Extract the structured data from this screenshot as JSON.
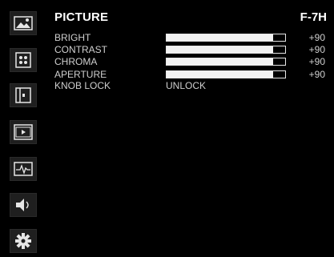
{
  "menu": {
    "title": "PICTURE",
    "model": "F-7H"
  },
  "sidebar": {
    "items": [
      {
        "icon": "picture-icon",
        "active": true
      },
      {
        "icon": "color-dots-icon"
      },
      {
        "icon": "frame-marker-icon"
      },
      {
        "icon": "film-icon"
      },
      {
        "icon": "waveform-icon"
      },
      {
        "icon": "speaker-icon"
      },
      {
        "icon": "gear-icon"
      }
    ]
  },
  "settings": [
    {
      "label": "BRIGHT",
      "value": "+90",
      "level": 0.9
    },
    {
      "label": "CONTRAST",
      "value": "+90",
      "level": 0.9
    },
    {
      "label": "CHROMA",
      "value": "+90",
      "level": 0.9
    },
    {
      "label": "APERTURE",
      "value": "+90",
      "level": 0.9
    },
    {
      "label": "KNOB LOCK",
      "value": "UNLOCK"
    }
  ],
  "colors": {
    "background": "#000000",
    "text": "#cfcfcf",
    "bar": "#f2f2f2",
    "sidebar_tile": "#1f1f1f"
  }
}
